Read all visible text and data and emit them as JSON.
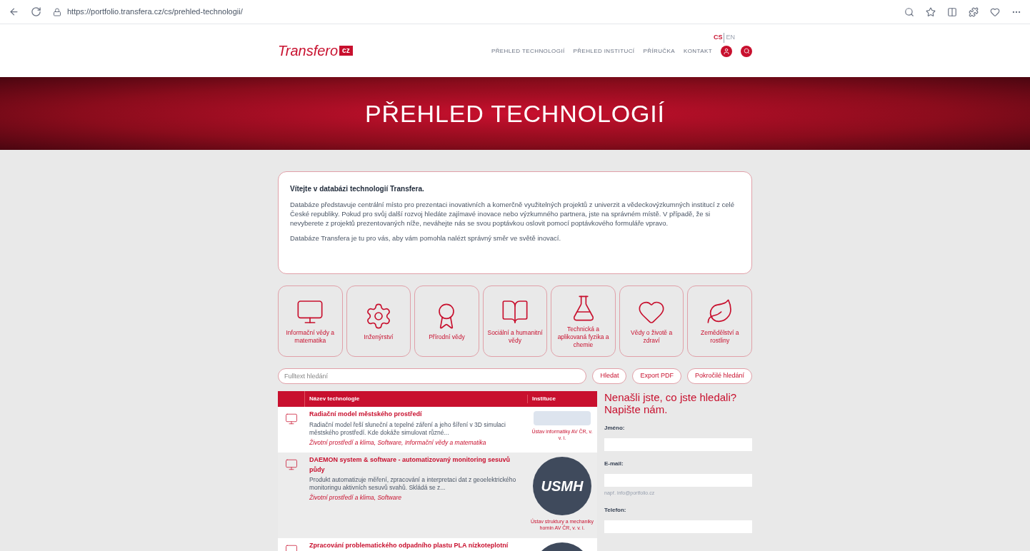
{
  "browser": {
    "url": "https://portfolio.transfera.cz/cs/prehled-technologii/"
  },
  "header": {
    "logo": "Transfero",
    "logo_badge": "cz",
    "languages": [
      {
        "label": "CS",
        "selected": true
      },
      {
        "label": "EN",
        "selected": false
      }
    ],
    "nav": [
      "PŘEHLED TECHNOLOGIÍ",
      "PŘEHLED INSTITUCÍ",
      "PŘÍRUČKA",
      "KONTAKT"
    ]
  },
  "hero": {
    "title": "PŘEHLED TECHNOLOGIÍ"
  },
  "intro": {
    "title": "Vítejte v databázi technologií Transfera.",
    "paragraphs": [
      "Databáze představuje centrální místo pro prezentaci inovativních a komerčně využitelných projektů z univerzit a vědeckovýzkumných institucí z celé České republiky. Pokud pro svůj další rozvoj hledáte zajímavé inovace nebo výzkumného partnera, jste na správném místě. V případě, že si nevyberete z projektů prezentovaných níže, neváhejte nás se svou poptávkou oslovit pomocí poptávkového formuláře vpravo.",
      "Databáze Transfera je tu pro vás, aby vám pomohla nalézt správný směr ve světě inovací."
    ]
  },
  "categories": [
    {
      "kind": "computer",
      "label": "Informační vědy a matematika"
    },
    {
      "kind": "gears",
      "label": "Inženýrství"
    },
    {
      "kind": "seal",
      "label": "Přírodní vědy"
    },
    {
      "kind": "book",
      "label": "Sociální a humanitní vědy"
    },
    {
      "kind": "flask",
      "label": "Technická a aplikovaná fyzika a chemie"
    },
    {
      "kind": "heart",
      "label": "Vědy o životě a zdraví"
    },
    {
      "kind": "leaf",
      "label": "Zemědělství a rostliny"
    }
  ],
  "search": {
    "placeholder": "Fulltext hledání",
    "buttons": [
      "Hledat",
      "Export PDF",
      "Pokročilé hledání"
    ]
  },
  "table": {
    "columns": [
      "Název technologie",
      "Instituce"
    ],
    "rows": [
      {
        "title": "Radiační model městského prostředí",
        "description": "Radiační model řeší sluneční a tepelné záření a jeho šíření v 3D simulaci městského prostředí. Kde dokáže simulovat různé...",
        "tags": "Životní prostředí a klima, Software, Informační vědy a matematika",
        "kind": "wide-logo",
        "institution": "Ústav informatiky AV ČR, v. v. i."
      },
      {
        "title": "DAEMON system & software - automatizovaný monitoring sesuvů půdy",
        "description": "Produkt automatizuje měření, zpracování a interpretaci dat z geoelektrického monitoringu aktivních sesuvů svahů. Skládá se z...",
        "tags": "Životní prostředí a klima, Software",
        "kind": "round-logo",
        "logo_text": "USMH",
        "institution": "Ústav struktury a mechaniky hornin AV ČR, v. v. i."
      },
      {
        "title": "Zpracování problematického odpadního plastu PLA nízkoteplotní",
        "kind": "round-logo"
      }
    ]
  },
  "contact": {
    "title": "Nenašli jste, co jste hledali? Napište nám.",
    "fields": [
      {
        "label": "Jméno:"
      },
      {
        "label": "E-mail:",
        "hint": "např. info@portfolio.cz"
      },
      {
        "label": "Telefon:"
      }
    ]
  }
}
